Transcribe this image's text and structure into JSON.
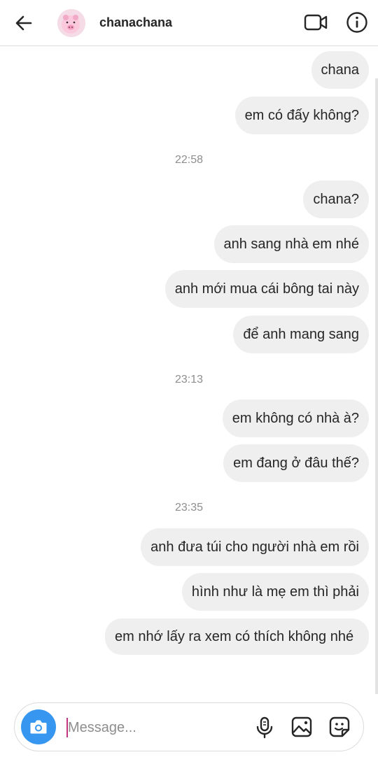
{
  "header": {
    "username": "chanachana",
    "icons": {
      "back": "arrow-left-icon",
      "video": "video-camera-icon",
      "info": "info-icon"
    }
  },
  "messages": [
    {
      "text": "chana"
    },
    {
      "text": "em có đấy không?"
    },
    {
      "text": "chana?"
    },
    {
      "text": "anh sang nhà em nhé"
    },
    {
      "text": "anh mới mua cái bông tai này"
    },
    {
      "text": "để anh mang sang"
    },
    {
      "text": "em không có nhà à?"
    },
    {
      "text": "em đang ở đâu thế?"
    },
    {
      "text": "anh đưa túi cho người nhà em rồi"
    },
    {
      "text": "hình như là mẹ em thì phải"
    },
    {
      "text": "em nhớ lấy ra xem có thích không nhé"
    }
  ],
  "timestamps": [
    "22:58",
    "23:13",
    "23:35"
  ],
  "composer": {
    "placeholder": "Message...",
    "icons": {
      "camera": "camera-icon",
      "mic": "microphone-icon",
      "gallery": "image-icon",
      "sticker": "sticker-icon"
    }
  },
  "colors": {
    "bubble": "#efefef",
    "camera_button": "#3797f0",
    "caret": "#c13584",
    "timestamp": "#8e8e8e"
  }
}
